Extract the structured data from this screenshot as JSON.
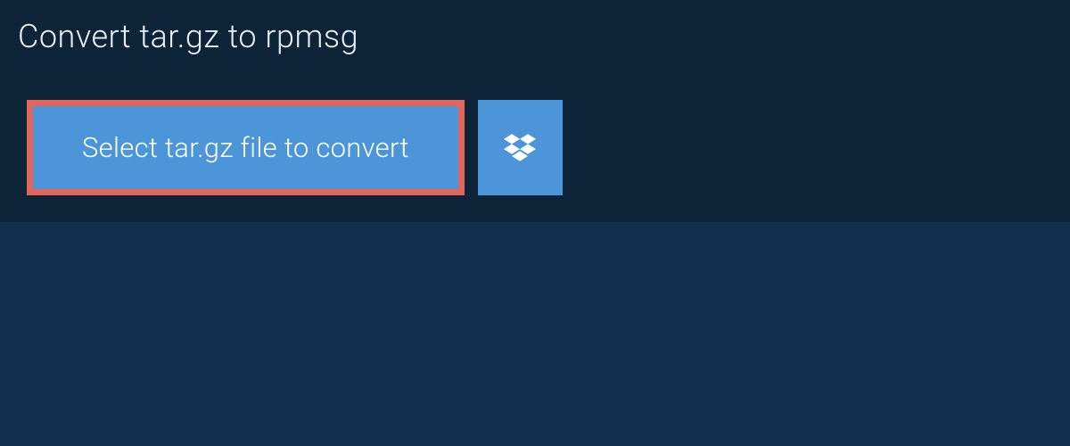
{
  "header": {
    "title": "Convert tar.gz to rpmsg"
  },
  "controls": {
    "select_label": "Select tar.gz file to convert",
    "dropbox_icon_name": "dropbox-icon"
  },
  "colors": {
    "background": "#13314f",
    "panel": "#0d2438",
    "button": "#4b95d8",
    "highlight_border": "#e16659",
    "text_light": "#e8eef4",
    "text_white": "#ffffff"
  }
}
